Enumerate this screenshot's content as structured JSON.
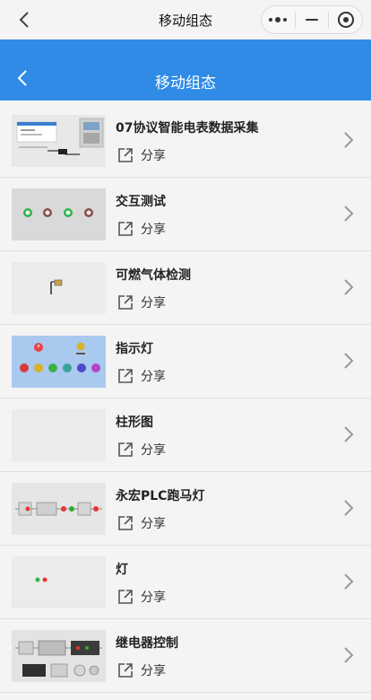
{
  "topbar": {
    "title": "移动组态"
  },
  "header": {
    "title": "移动组态"
  },
  "items": [
    {
      "title": "07协议智能电表数据采集",
      "share_label": "分享"
    },
    {
      "title": "交互测试",
      "share_label": "分享"
    },
    {
      "title": "可燃气体检测",
      "share_label": "分享"
    },
    {
      "title": "指示灯",
      "share_label": "分享"
    },
    {
      "title": "柱形图",
      "share_label": "分享"
    },
    {
      "title": "永宏PLC跑马灯",
      "share_label": "分享"
    },
    {
      "title": "灯",
      "share_label": "分享"
    },
    {
      "title": "继电器控制",
      "share_label": "分享"
    }
  ],
  "icons": {
    "back": "chevron-left-icon",
    "more": "more-dots-icon",
    "minimize": "minimize-icon",
    "close": "target-close-icon",
    "share": "share-icon",
    "chevron": "chevron-right-icon"
  },
  "colors": {
    "header_bg": "#2f8be6",
    "page_bg": "#f4f4f4"
  }
}
